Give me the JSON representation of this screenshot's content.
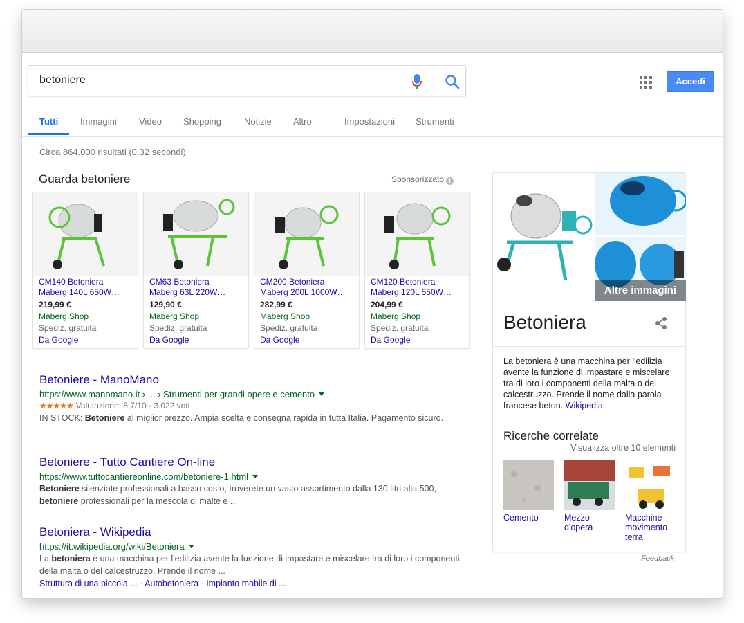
{
  "search": {
    "query": "betoniere"
  },
  "header": {
    "signin_label": "Accedi"
  },
  "tabs": [
    {
      "label": "Tutti"
    },
    {
      "label": "Immagini"
    },
    {
      "label": "Video"
    },
    {
      "label": "Shopping"
    },
    {
      "label": "Notizie"
    },
    {
      "label": "Altro"
    },
    {
      "label": "Impostazioni"
    },
    {
      "label": "Strumenti"
    }
  ],
  "result_stats": "Circa 864.000 risultati (0,32 secondi)",
  "shopping": {
    "title": "Guarda betoniere",
    "sponsored": "Sponsorizzato",
    "products": [
      {
        "title1": "CM140 Betoniera",
        "title2": "Maberg 140L 650W…",
        "price": "219,99 €",
        "store": "Maberg Shop",
        "shipping": "Spediz. gratuita",
        "source": "Da Google"
      },
      {
        "title1": "CM63 Betoniera",
        "title2": "Maberg 63L 220W…",
        "price": "129,90 €",
        "store": "Maberg Shop",
        "shipping": "Spediz. gratuita",
        "source": "Da Google"
      },
      {
        "title1": "CM200 Betoniera",
        "title2": "Maberg 200L 1000W…",
        "price": "282,99 €",
        "store": "Maberg Shop",
        "shipping": "Spediz. gratuita",
        "source": "Da Google"
      },
      {
        "title1": "CM120 Betoniera",
        "title2": "Maberg 120L 550W…",
        "price": "204,99 €",
        "store": "Maberg Shop",
        "shipping": "Spediz. gratuita",
        "source": "Da Google"
      }
    ]
  },
  "results": [
    {
      "title": "Betoniere - ManoMano",
      "url": "https://www.manomano.it › ... › Strumenti per grandi opere e cemento",
      "stars": "★★★★★",
      "rating": "Valutazione: 8,7/10 - 3.022 voti",
      "snippet_lead": "IN STOCK:",
      "snippet_bold": "Betoniere",
      "snippet_rest": "al miglior prezzo. Ampia scelta e consegna rapida in tutta Italia. Pagamento sicuro."
    },
    {
      "title": "Betoniere - Tutto Cantiere On-line",
      "url": "https://www.tuttocantiereonline.com/betoniere-1.html",
      "snippet_bold": "Betoniere",
      "snippet_mid": "silenziate professionali a basso costo, troverete un vasto assortimento dalla 130 litri alla 500,",
      "snippet_bold2": "betoniere",
      "snippet_rest": "professionali per la mescola di malte e ..."
    },
    {
      "title": "Betoniera - Wikipedia",
      "url": "https://it.wikipedia.org/wiki/Betoniera",
      "snippet_lead": "La",
      "snippet_bold": "betoniera",
      "snippet_rest": "è una macchina per l'edilizia avente la funzione di impastare e miscelare tra di loro i componenti della malta o del calcestruzzo. Prende il nome ...",
      "sitelinks": [
        "Struttura di una piccola ...",
        "Autobetoniera",
        "Impianto mobile di ..."
      ]
    }
  ],
  "knowledge_panel": {
    "more_images": "Altre immagini",
    "title": "Betoniera",
    "description": "La betoniera è una macchina per l'edilizia avente la funzione di impastare e miscelare tra di loro i componenti della malta o del calcestruzzo. Prende il nome dalla parola francese beton.",
    "source": "Wikipedia",
    "related_title": "Ricerche correlate",
    "related_more": "Visualizza oltre 10 elementi",
    "related": [
      {
        "label": "Cemento"
      },
      {
        "label": "Mezzo d'opera"
      },
      {
        "label": "Macchine movimento terra"
      }
    ]
  },
  "feedback": "Feedback",
  "colors": {
    "link": "#1a0dab",
    "url": "#006621",
    "accent": "#1a73e8",
    "signin": "#4a8af4"
  }
}
